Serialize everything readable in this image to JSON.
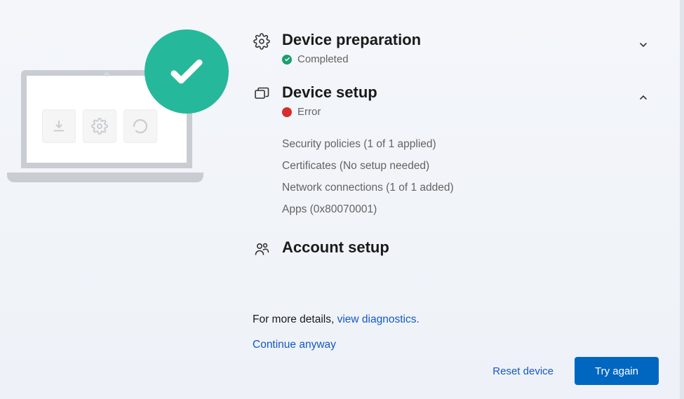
{
  "sections": {
    "preparation": {
      "title": "Device preparation",
      "status_label": "Completed",
      "status_kind": "ok",
      "expanded": false
    },
    "setup": {
      "title": "Device setup",
      "status_label": "Error",
      "status_kind": "error",
      "expanded": true,
      "details": [
        "Security policies (1 of 1 applied)",
        "Certificates (No setup needed)",
        "Network connections (1 of 1 added)",
        "Apps (0x80070001)"
      ]
    },
    "account": {
      "title": "Account setup"
    }
  },
  "footer": {
    "more_prefix": "For more details, ",
    "more_link": "view diagnostics.",
    "continue_label": "Continue anyway",
    "reset_label": "Reset device",
    "tryagain_label": "Try again"
  }
}
